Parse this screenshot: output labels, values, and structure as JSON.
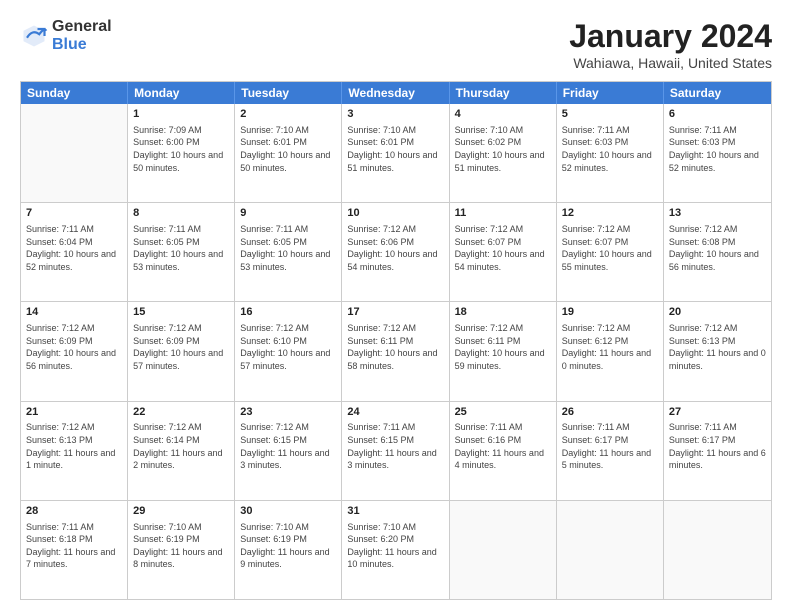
{
  "logo": {
    "general": "General",
    "blue": "Blue"
  },
  "title": {
    "month": "January 2024",
    "location": "Wahiawa, Hawaii, United States"
  },
  "header_days": [
    "Sunday",
    "Monday",
    "Tuesday",
    "Wednesday",
    "Thursday",
    "Friday",
    "Saturday"
  ],
  "weeks": [
    [
      {
        "day": "",
        "sunrise": "",
        "sunset": "",
        "daylight": ""
      },
      {
        "day": "1",
        "sunrise": "Sunrise: 7:09 AM",
        "sunset": "Sunset: 6:00 PM",
        "daylight": "Daylight: 10 hours and 50 minutes."
      },
      {
        "day": "2",
        "sunrise": "Sunrise: 7:10 AM",
        "sunset": "Sunset: 6:01 PM",
        "daylight": "Daylight: 10 hours and 50 minutes."
      },
      {
        "day": "3",
        "sunrise": "Sunrise: 7:10 AM",
        "sunset": "Sunset: 6:01 PM",
        "daylight": "Daylight: 10 hours and 51 minutes."
      },
      {
        "day": "4",
        "sunrise": "Sunrise: 7:10 AM",
        "sunset": "Sunset: 6:02 PM",
        "daylight": "Daylight: 10 hours and 51 minutes."
      },
      {
        "day": "5",
        "sunrise": "Sunrise: 7:11 AM",
        "sunset": "Sunset: 6:03 PM",
        "daylight": "Daylight: 10 hours and 52 minutes."
      },
      {
        "day": "6",
        "sunrise": "Sunrise: 7:11 AM",
        "sunset": "Sunset: 6:03 PM",
        "daylight": "Daylight: 10 hours and 52 minutes."
      }
    ],
    [
      {
        "day": "7",
        "sunrise": "Sunrise: 7:11 AM",
        "sunset": "Sunset: 6:04 PM",
        "daylight": "Daylight: 10 hours and 52 minutes."
      },
      {
        "day": "8",
        "sunrise": "Sunrise: 7:11 AM",
        "sunset": "Sunset: 6:05 PM",
        "daylight": "Daylight: 10 hours and 53 minutes."
      },
      {
        "day": "9",
        "sunrise": "Sunrise: 7:11 AM",
        "sunset": "Sunset: 6:05 PM",
        "daylight": "Daylight: 10 hours and 53 minutes."
      },
      {
        "day": "10",
        "sunrise": "Sunrise: 7:12 AM",
        "sunset": "Sunset: 6:06 PM",
        "daylight": "Daylight: 10 hours and 54 minutes."
      },
      {
        "day": "11",
        "sunrise": "Sunrise: 7:12 AM",
        "sunset": "Sunset: 6:07 PM",
        "daylight": "Daylight: 10 hours and 54 minutes."
      },
      {
        "day": "12",
        "sunrise": "Sunrise: 7:12 AM",
        "sunset": "Sunset: 6:07 PM",
        "daylight": "Daylight: 10 hours and 55 minutes."
      },
      {
        "day": "13",
        "sunrise": "Sunrise: 7:12 AM",
        "sunset": "Sunset: 6:08 PM",
        "daylight": "Daylight: 10 hours and 56 minutes."
      }
    ],
    [
      {
        "day": "14",
        "sunrise": "Sunrise: 7:12 AM",
        "sunset": "Sunset: 6:09 PM",
        "daylight": "Daylight: 10 hours and 56 minutes."
      },
      {
        "day": "15",
        "sunrise": "Sunrise: 7:12 AM",
        "sunset": "Sunset: 6:09 PM",
        "daylight": "Daylight: 10 hours and 57 minutes."
      },
      {
        "day": "16",
        "sunrise": "Sunrise: 7:12 AM",
        "sunset": "Sunset: 6:10 PM",
        "daylight": "Daylight: 10 hours and 57 minutes."
      },
      {
        "day": "17",
        "sunrise": "Sunrise: 7:12 AM",
        "sunset": "Sunset: 6:11 PM",
        "daylight": "Daylight: 10 hours and 58 minutes."
      },
      {
        "day": "18",
        "sunrise": "Sunrise: 7:12 AM",
        "sunset": "Sunset: 6:11 PM",
        "daylight": "Daylight: 10 hours and 59 minutes."
      },
      {
        "day": "19",
        "sunrise": "Sunrise: 7:12 AM",
        "sunset": "Sunset: 6:12 PM",
        "daylight": "Daylight: 11 hours and 0 minutes."
      },
      {
        "day": "20",
        "sunrise": "Sunrise: 7:12 AM",
        "sunset": "Sunset: 6:13 PM",
        "daylight": "Daylight: 11 hours and 0 minutes."
      }
    ],
    [
      {
        "day": "21",
        "sunrise": "Sunrise: 7:12 AM",
        "sunset": "Sunset: 6:13 PM",
        "daylight": "Daylight: 11 hours and 1 minute."
      },
      {
        "day": "22",
        "sunrise": "Sunrise: 7:12 AM",
        "sunset": "Sunset: 6:14 PM",
        "daylight": "Daylight: 11 hours and 2 minutes."
      },
      {
        "day": "23",
        "sunrise": "Sunrise: 7:12 AM",
        "sunset": "Sunset: 6:15 PM",
        "daylight": "Daylight: 11 hours and 3 minutes."
      },
      {
        "day": "24",
        "sunrise": "Sunrise: 7:11 AM",
        "sunset": "Sunset: 6:15 PM",
        "daylight": "Daylight: 11 hours and 3 minutes."
      },
      {
        "day": "25",
        "sunrise": "Sunrise: 7:11 AM",
        "sunset": "Sunset: 6:16 PM",
        "daylight": "Daylight: 11 hours and 4 minutes."
      },
      {
        "day": "26",
        "sunrise": "Sunrise: 7:11 AM",
        "sunset": "Sunset: 6:17 PM",
        "daylight": "Daylight: 11 hours and 5 minutes."
      },
      {
        "day": "27",
        "sunrise": "Sunrise: 7:11 AM",
        "sunset": "Sunset: 6:17 PM",
        "daylight": "Daylight: 11 hours and 6 minutes."
      }
    ],
    [
      {
        "day": "28",
        "sunrise": "Sunrise: 7:11 AM",
        "sunset": "Sunset: 6:18 PM",
        "daylight": "Daylight: 11 hours and 7 minutes."
      },
      {
        "day": "29",
        "sunrise": "Sunrise: 7:10 AM",
        "sunset": "Sunset: 6:19 PM",
        "daylight": "Daylight: 11 hours and 8 minutes."
      },
      {
        "day": "30",
        "sunrise": "Sunrise: 7:10 AM",
        "sunset": "Sunset: 6:19 PM",
        "daylight": "Daylight: 11 hours and 9 minutes."
      },
      {
        "day": "31",
        "sunrise": "Sunrise: 7:10 AM",
        "sunset": "Sunset: 6:20 PM",
        "daylight": "Daylight: 11 hours and 10 minutes."
      },
      {
        "day": "",
        "sunrise": "",
        "sunset": "",
        "daylight": ""
      },
      {
        "day": "",
        "sunrise": "",
        "sunset": "",
        "daylight": ""
      },
      {
        "day": "",
        "sunrise": "",
        "sunset": "",
        "daylight": ""
      }
    ]
  ]
}
